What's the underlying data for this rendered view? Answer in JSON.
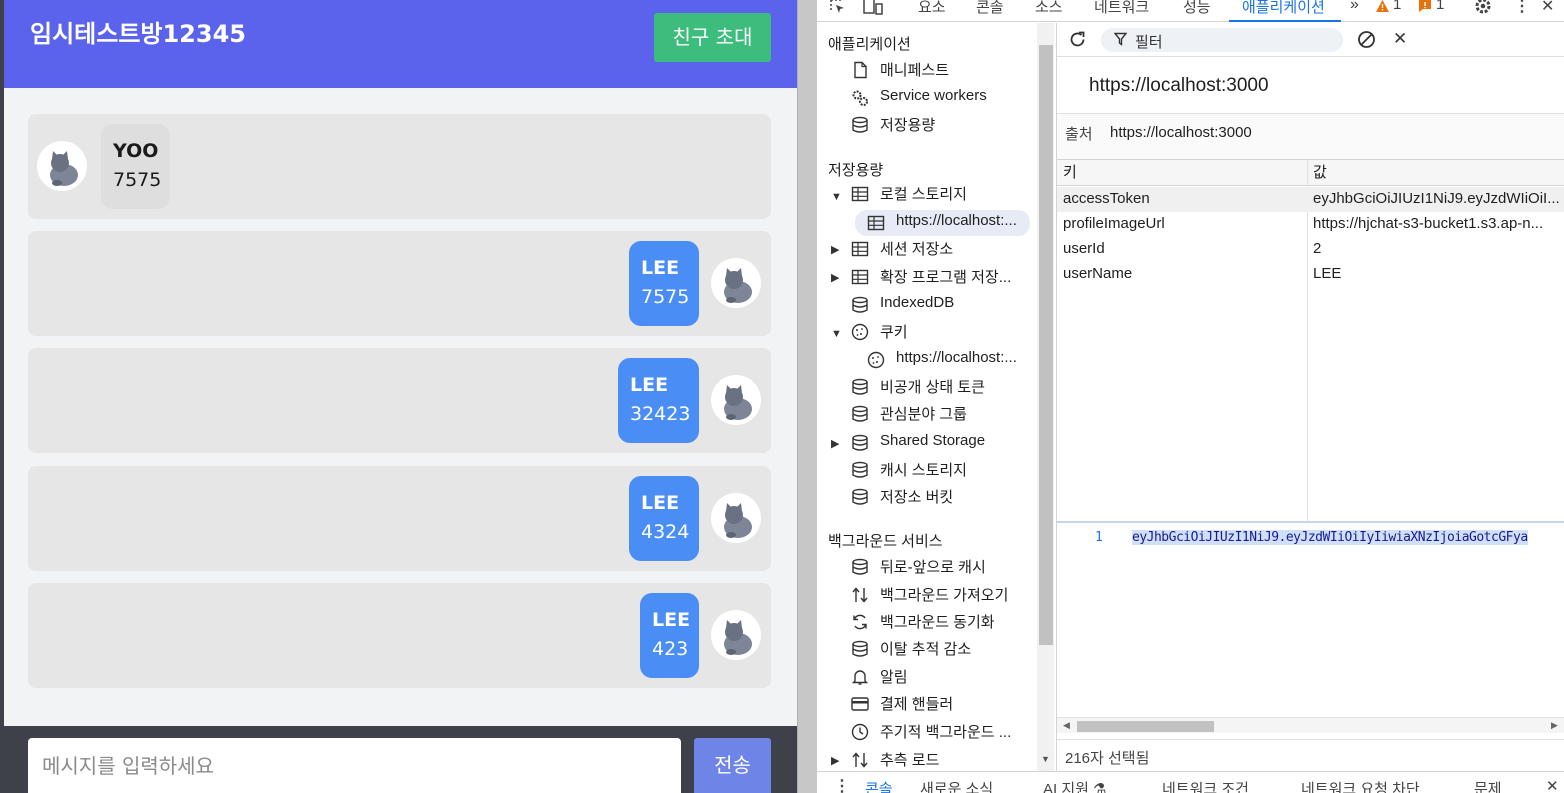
{
  "chat": {
    "room_title": "임시테스트방12345",
    "invite_button": "친구 초대",
    "messages": [
      {
        "side": "other",
        "user": "YOO",
        "text": "7575"
      },
      {
        "side": "mine",
        "user": "LEE",
        "text": "7575"
      },
      {
        "side": "mine",
        "user": "LEE",
        "text": "32423"
      },
      {
        "side": "mine",
        "user": "LEE",
        "text": "4324"
      },
      {
        "side": "mine",
        "user": "LEE",
        "text": "423"
      }
    ],
    "input_placeholder": "메시지를 입력하세요",
    "send_button": "전송",
    "colors": {
      "header": "#5b63ec",
      "invite": "#3dbd7d",
      "mine_bubble": "#4a8df5",
      "send": "#6e84e6"
    }
  },
  "devtools": {
    "tabs": [
      "요소",
      "콘솔",
      "소스",
      "네트워크",
      "성능",
      "애플리케이션"
    ],
    "active_tab": "애플리케이션",
    "warning_count": "1",
    "error_count": "1",
    "sidebar": {
      "section_application": "애플리케이션",
      "manifest": "매니페스트",
      "service_workers": "Service workers",
      "storage_overview": "저장용량",
      "section_storage": "저장용량",
      "local_storage": "로컬 스토리지",
      "local_storage_origin": "https://localhost:...",
      "session_storage": "세션 저장소",
      "extension_storage": "확장 프로그램 저장...",
      "indexeddb": "IndexedDB",
      "cookies": "쿠키",
      "cookies_origin": "https://localhost:...",
      "private_state_tokens": "비공개 상태 토큰",
      "interest_groups": "관심분야 그룹",
      "shared_storage": "Shared Storage",
      "cache_storage": "캐시 스토리지",
      "storage_buckets": "저장소 버킷",
      "section_background": "백그라운드 서비스",
      "back_forward_cache": "뒤로-앞으로 캐시",
      "background_fetch": "백그라운드 가져오기",
      "background_sync": "백그라운드 동기화",
      "bounce_tracking": "이탈 추적 감소",
      "notifications": "알림",
      "payment_handler": "결제 핸들러",
      "periodic_background_sync": "주기적 백그라운드 ...",
      "speculative_loads": "추측 로드"
    },
    "filter_placeholder": "필터",
    "origin_title": "https://localhost:3000",
    "origin_label": "출처",
    "origin_value": "https://localhost:3000",
    "table": {
      "key_header": "키",
      "value_header": "값",
      "rows": [
        {
          "key": "accessToken",
          "value": "eyJhbGciOiJIUzI1NiJ9.eyJzdWIiOiI..."
        },
        {
          "key": "profileImageUrl",
          "value": "https://hjchat-s3-bucket1.s3.ap-n..."
        },
        {
          "key": "userId",
          "value": "2"
        },
        {
          "key": "userName",
          "value": "LEE"
        }
      ]
    },
    "preview": {
      "line_number": "1",
      "code": "eyJhbGciOiJIUzI1NiJ9.eyJzdWIiOiIyIiwiaXNzIjoiaGotcGFya"
    },
    "status_text": "216자 선택됨",
    "drawer_tabs": [
      "콘솔",
      "새로운 소식",
      "AI 지원 ⚗",
      "네트워크 조건",
      "네트워크 요청 차단",
      "문제"
    ],
    "drawer_active": "콘솔"
  }
}
